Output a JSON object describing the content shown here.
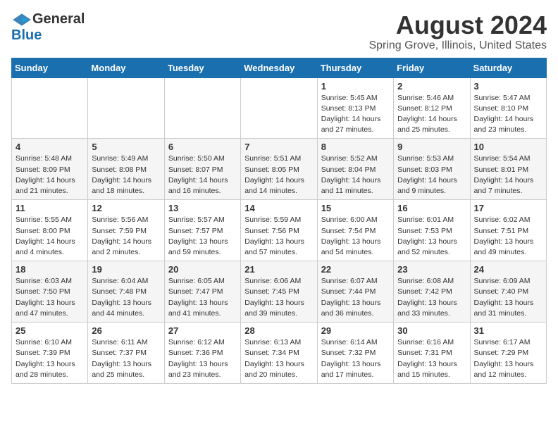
{
  "header": {
    "logo_general": "General",
    "logo_blue": "Blue",
    "month_title": "August 2024",
    "location": "Spring Grove, Illinois, United States"
  },
  "days_of_week": [
    "Sunday",
    "Monday",
    "Tuesday",
    "Wednesday",
    "Thursday",
    "Friday",
    "Saturday"
  ],
  "weeks": [
    [
      {
        "day": "",
        "info": ""
      },
      {
        "day": "",
        "info": ""
      },
      {
        "day": "",
        "info": ""
      },
      {
        "day": "",
        "info": ""
      },
      {
        "day": "1",
        "info": "Sunrise: 5:45 AM\nSunset: 8:13 PM\nDaylight: 14 hours\nand 27 minutes."
      },
      {
        "day": "2",
        "info": "Sunrise: 5:46 AM\nSunset: 8:12 PM\nDaylight: 14 hours\nand 25 minutes."
      },
      {
        "day": "3",
        "info": "Sunrise: 5:47 AM\nSunset: 8:10 PM\nDaylight: 14 hours\nand 23 minutes."
      }
    ],
    [
      {
        "day": "4",
        "info": "Sunrise: 5:48 AM\nSunset: 8:09 PM\nDaylight: 14 hours\nand 21 minutes."
      },
      {
        "day": "5",
        "info": "Sunrise: 5:49 AM\nSunset: 8:08 PM\nDaylight: 14 hours\nand 18 minutes."
      },
      {
        "day": "6",
        "info": "Sunrise: 5:50 AM\nSunset: 8:07 PM\nDaylight: 14 hours\nand 16 minutes."
      },
      {
        "day": "7",
        "info": "Sunrise: 5:51 AM\nSunset: 8:05 PM\nDaylight: 14 hours\nand 14 minutes."
      },
      {
        "day": "8",
        "info": "Sunrise: 5:52 AM\nSunset: 8:04 PM\nDaylight: 14 hours\nand 11 minutes."
      },
      {
        "day": "9",
        "info": "Sunrise: 5:53 AM\nSunset: 8:03 PM\nDaylight: 14 hours\nand 9 minutes."
      },
      {
        "day": "10",
        "info": "Sunrise: 5:54 AM\nSunset: 8:01 PM\nDaylight: 14 hours\nand 7 minutes."
      }
    ],
    [
      {
        "day": "11",
        "info": "Sunrise: 5:55 AM\nSunset: 8:00 PM\nDaylight: 14 hours\nand 4 minutes."
      },
      {
        "day": "12",
        "info": "Sunrise: 5:56 AM\nSunset: 7:59 PM\nDaylight: 14 hours\nand 2 minutes."
      },
      {
        "day": "13",
        "info": "Sunrise: 5:57 AM\nSunset: 7:57 PM\nDaylight: 13 hours\nand 59 minutes."
      },
      {
        "day": "14",
        "info": "Sunrise: 5:59 AM\nSunset: 7:56 PM\nDaylight: 13 hours\nand 57 minutes."
      },
      {
        "day": "15",
        "info": "Sunrise: 6:00 AM\nSunset: 7:54 PM\nDaylight: 13 hours\nand 54 minutes."
      },
      {
        "day": "16",
        "info": "Sunrise: 6:01 AM\nSunset: 7:53 PM\nDaylight: 13 hours\nand 52 minutes."
      },
      {
        "day": "17",
        "info": "Sunrise: 6:02 AM\nSunset: 7:51 PM\nDaylight: 13 hours\nand 49 minutes."
      }
    ],
    [
      {
        "day": "18",
        "info": "Sunrise: 6:03 AM\nSunset: 7:50 PM\nDaylight: 13 hours\nand 47 minutes."
      },
      {
        "day": "19",
        "info": "Sunrise: 6:04 AM\nSunset: 7:48 PM\nDaylight: 13 hours\nand 44 minutes."
      },
      {
        "day": "20",
        "info": "Sunrise: 6:05 AM\nSunset: 7:47 PM\nDaylight: 13 hours\nand 41 minutes."
      },
      {
        "day": "21",
        "info": "Sunrise: 6:06 AM\nSunset: 7:45 PM\nDaylight: 13 hours\nand 39 minutes."
      },
      {
        "day": "22",
        "info": "Sunrise: 6:07 AM\nSunset: 7:44 PM\nDaylight: 13 hours\nand 36 minutes."
      },
      {
        "day": "23",
        "info": "Sunrise: 6:08 AM\nSunset: 7:42 PM\nDaylight: 13 hours\nand 33 minutes."
      },
      {
        "day": "24",
        "info": "Sunrise: 6:09 AM\nSunset: 7:40 PM\nDaylight: 13 hours\nand 31 minutes."
      }
    ],
    [
      {
        "day": "25",
        "info": "Sunrise: 6:10 AM\nSunset: 7:39 PM\nDaylight: 13 hours\nand 28 minutes."
      },
      {
        "day": "26",
        "info": "Sunrise: 6:11 AM\nSunset: 7:37 PM\nDaylight: 13 hours\nand 25 minutes."
      },
      {
        "day": "27",
        "info": "Sunrise: 6:12 AM\nSunset: 7:36 PM\nDaylight: 13 hours\nand 23 minutes."
      },
      {
        "day": "28",
        "info": "Sunrise: 6:13 AM\nSunset: 7:34 PM\nDaylight: 13 hours\nand 20 minutes."
      },
      {
        "day": "29",
        "info": "Sunrise: 6:14 AM\nSunset: 7:32 PM\nDaylight: 13 hours\nand 17 minutes."
      },
      {
        "day": "30",
        "info": "Sunrise: 6:16 AM\nSunset: 7:31 PM\nDaylight: 13 hours\nand 15 minutes."
      },
      {
        "day": "31",
        "info": "Sunrise: 6:17 AM\nSunset: 7:29 PM\nDaylight: 13 hours\nand 12 minutes."
      }
    ]
  ]
}
